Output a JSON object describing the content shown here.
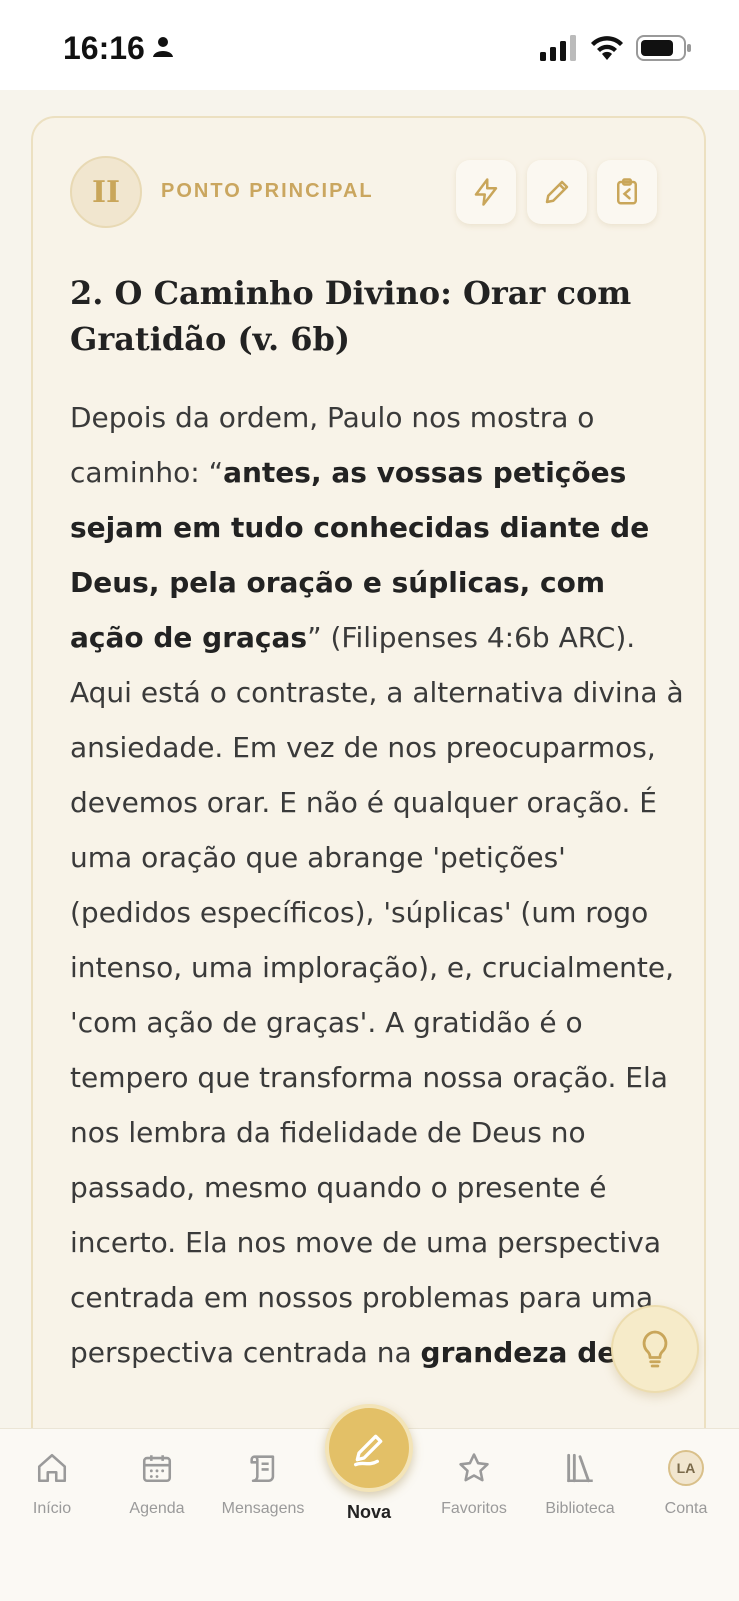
{
  "status": {
    "time": "16:16"
  },
  "point": {
    "numeral": "II",
    "section_label": "PONTO PRINCIPAL",
    "title": "2. O Caminho Divino: Orar com Gratidão (v. 6b)",
    "body": [
      {
        "t": "Depois da ordem, Paulo nos mostra o caminho: “",
        "b": false
      },
      {
        "t": "antes, as vossas petições sejam em tudo conhecidas diante de Deus, pela oração e súplicas, com ação de graças",
        "b": true
      },
      {
        "t": "” (Filipenses 4:6b ARC). Aqui está o contraste, a alternativa divina à ansiedade. Em vez de nos preocuparmos, devemos orar. E não é qualquer oração. É uma oração que abrange 'petições' (pedidos específicos), 'súplicas' (um rogo intenso, uma imploração), e, crucialmente, 'com ação de graças'. A gratidão é o tempero que transforma nossa oração. Ela nos lembra da fidelidade de Deus no passado, mesmo quando o presente é incerto. Ela nos move de uma perspectiva centrada em nossos problemas para uma perspectiva centrada na ",
        "b": false
      },
      {
        "t": "grandeza de",
        "b": true
      }
    ]
  },
  "tabs": [
    {
      "label": "Início",
      "icon": "home-icon"
    },
    {
      "label": "Agenda",
      "icon": "calendar-icon"
    },
    {
      "label": "Mensagens",
      "icon": "scroll-icon"
    },
    {
      "label": "Nova",
      "icon": "pen-icon"
    },
    {
      "label": "Favoritos",
      "icon": "star-icon"
    },
    {
      "label": "Biblioteca",
      "icon": "books-icon"
    },
    {
      "label": "Conta",
      "icon": "avatar",
      "avatar_initials": "LA"
    }
  ],
  "colors": {
    "accent": "#e3c067",
    "label_gold": "#caa65f",
    "background": "#f7f4ec"
  }
}
